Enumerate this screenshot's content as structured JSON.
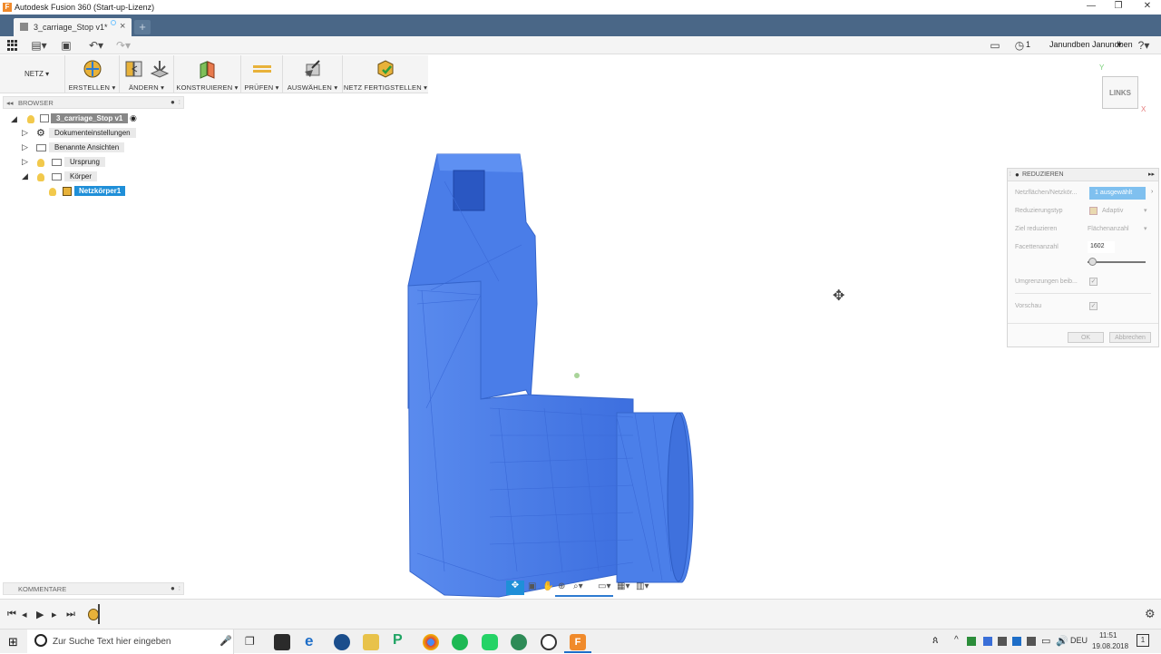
{
  "window": {
    "title": "Autodesk Fusion 360 (Start-up-Lizenz)",
    "app_icon_letter": "F"
  },
  "tabs": [
    {
      "label": "3_carriage_Stop v1*"
    }
  ],
  "quick_access": {
    "notifications_count": "1",
    "user_name": "Janundben Janundben"
  },
  "toolbar": {
    "workspace_label": "NETZ",
    "groups": [
      {
        "label": "ERSTELLEN"
      },
      {
        "label": "ÄNDERN"
      },
      {
        "label": "KONSTRUIEREN"
      },
      {
        "label": "PRÜFEN"
      },
      {
        "label": "AUSWÄHLEN"
      },
      {
        "label": "NETZ FERTIGSTELLEN"
      }
    ]
  },
  "browser": {
    "header": "BROWSER",
    "root": "3_carriage_Stop v1",
    "items": [
      {
        "label": "Dokumenteinstellungen"
      },
      {
        "label": "Benannte Ansichten"
      },
      {
        "label": "Ursprung"
      },
      {
        "label": "Körper"
      },
      {
        "label": "Netzkörper1"
      }
    ]
  },
  "comments": {
    "header": "KOMMENTARE"
  },
  "viewcube": {
    "label": "LINKS"
  },
  "panel": {
    "title": "REDUZIEREN",
    "rows": [
      {
        "label": "Netzflächen/Netzkör...",
        "value": "1 ausgewählt"
      },
      {
        "label": "Reduzierungstyp",
        "value": "Adaptiv"
      },
      {
        "label": "Ziel reduzieren",
        "value": "Flächenanzahl"
      },
      {
        "label": "Facettenanzahl",
        "value": "1602"
      },
      {
        "label": "Umgrenzungen beib...",
        "value": ""
      },
      {
        "label": "Vorschau",
        "value": ""
      }
    ],
    "slider_fraction": 0.08,
    "ok_label": "OK",
    "cancel_label": "Abbrechen"
  },
  "taskbar": {
    "search_placeholder": "Zur Suche Text hier eingeben",
    "language": "DEU",
    "time": "11:51",
    "date": "19.08.2018",
    "notification_count": "1"
  },
  "colors": {
    "model_blue": "#4a7de8",
    "tab_bar": "#4a6787",
    "selection": "#1f8fd8"
  }
}
